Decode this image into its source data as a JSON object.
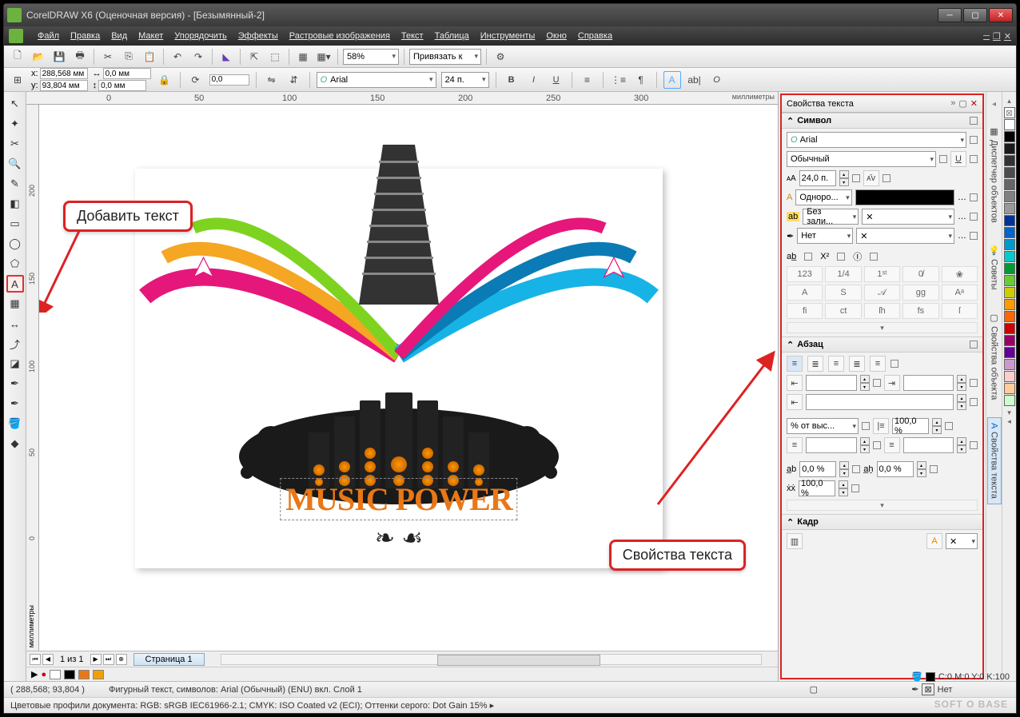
{
  "window": {
    "title": "CorelDRAW X6 (Оценочная версия) - [Безымянный-2]"
  },
  "menu": {
    "items": [
      "Файл",
      "Правка",
      "Вид",
      "Макет",
      "Упорядочить",
      "Эффекты",
      "Растровые изображения",
      "Текст",
      "Таблица",
      "Инструменты",
      "Окно",
      "Справка"
    ]
  },
  "toolbar1": {
    "zoom": "58%",
    "snap_label": "Привязать к"
  },
  "propbar": {
    "x": "288,568 мм",
    "y": "93,804 мм",
    "w": "0,0 мм",
    "h": "0,0 мм",
    "angle": "0,0",
    "font": "Arial",
    "size": "24 п."
  },
  "ruler": {
    "unit_h": "миллиметры",
    "unit_v": "миллиметры",
    "h_ticks": [
      "0",
      "50",
      "100",
      "150",
      "200",
      "250",
      "300"
    ],
    "v_ticks": [
      "200",
      "150",
      "100",
      "50",
      "0"
    ]
  },
  "callouts": {
    "add_text": "Добавить текст",
    "text_props": "Свойства текста"
  },
  "artwork": {
    "text": "MUSIC POWER"
  },
  "pagebar": {
    "page_info": "1 из 1",
    "tab": "Страница 1"
  },
  "mediabar_colors": [
    "#ffffff",
    "#000000",
    "#e87817",
    "#f0a000"
  ],
  "status": {
    "coords": "( 288,568; 93,804 )",
    "info": "Фигурный текст, символов: Arial (Обычный) (ENU) вкл. Слой 1"
  },
  "profiles": "Цветовые профили документа: RGB: sRGB IEC61966-2.1; CMYK: ISO Coated v2 (ECI); Оттенки серого: Dot Gain 15% ▸",
  "fill_info": {
    "cmyk": "C:0 M:0 Y:0 K:100",
    "outline": "Нет"
  },
  "docker": {
    "title": "Свойства текста",
    "sections": {
      "symbol": {
        "head": "Символ",
        "font": "Arial",
        "style": "Обычный",
        "size": "24,0 п.",
        "fill_mode": "Одноро...",
        "bg_mode": "Без зали...",
        "outline_mode": "Нет"
      },
      "paragraph": {
        "head": "Абзац",
        "spacing_mode": "% от выс...",
        "spacing_val": "100,0 %",
        "kern_a": "0,0 %",
        "kern_b": "0,0 %",
        "kern_c": "100,0 %"
      },
      "frame": {
        "head": "Кадр"
      }
    }
  },
  "side_tabs": [
    "Диспетчер объектов",
    "Советы",
    "Свойства объекта",
    "Свойства текста"
  ],
  "color_strip": [
    "#ffffff",
    "#000000",
    "#1a1a1a",
    "#333333",
    "#4d4d4d",
    "#666666",
    "#808080",
    "#999999",
    "#003399",
    "#0066cc",
    "#0099cc",
    "#00cccc",
    "#009933",
    "#66cc33",
    "#cccc00",
    "#ff9900",
    "#ff6600",
    "#cc0000",
    "#990066",
    "#660099",
    "#cc99cc",
    "#ffcccc",
    "#ffcc99",
    "#ccffcc"
  ],
  "watermark": "SOFT O BASE"
}
